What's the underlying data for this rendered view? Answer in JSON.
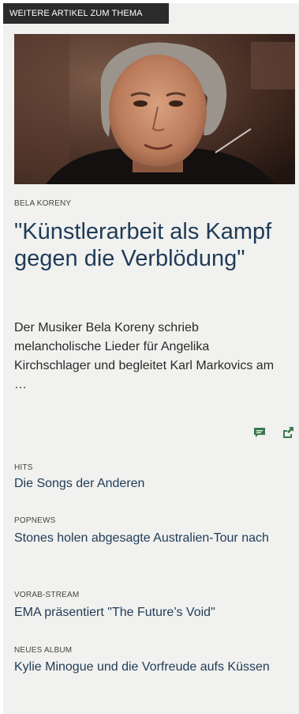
{
  "section": {
    "title": "WEITERE ARTIKEL ZUM THEMA"
  },
  "featured": {
    "image_alt": "Bela Koreny",
    "kicker": "BELA KORENY",
    "headline": "\"Künstlerarbeit als Kampf gegen die Verblödung\"",
    "teaser": "Der Musiker Bela Koreny schrieb melancholische Lieder für Angelika Kirchschlager und begleitet Karl Markovics am …"
  },
  "icons": {
    "comment": "comment-icon",
    "share": "share-icon",
    "color": "#3a7a4e"
  },
  "related": [
    {
      "kicker": "HITS",
      "title": "Die Songs der Anderen"
    },
    {
      "kicker": "POPNEWS",
      "title": "Stones holen abgesagte Australien-Tour nach"
    },
    {
      "kicker": "VORAB-STREAM",
      "title": "EMA präsentiert \"The Future’s Void\""
    },
    {
      "kicker": "NEUES ALBUM",
      "title": "Kylie Minogue und die Vorfreude aufs Küssen"
    }
  ]
}
